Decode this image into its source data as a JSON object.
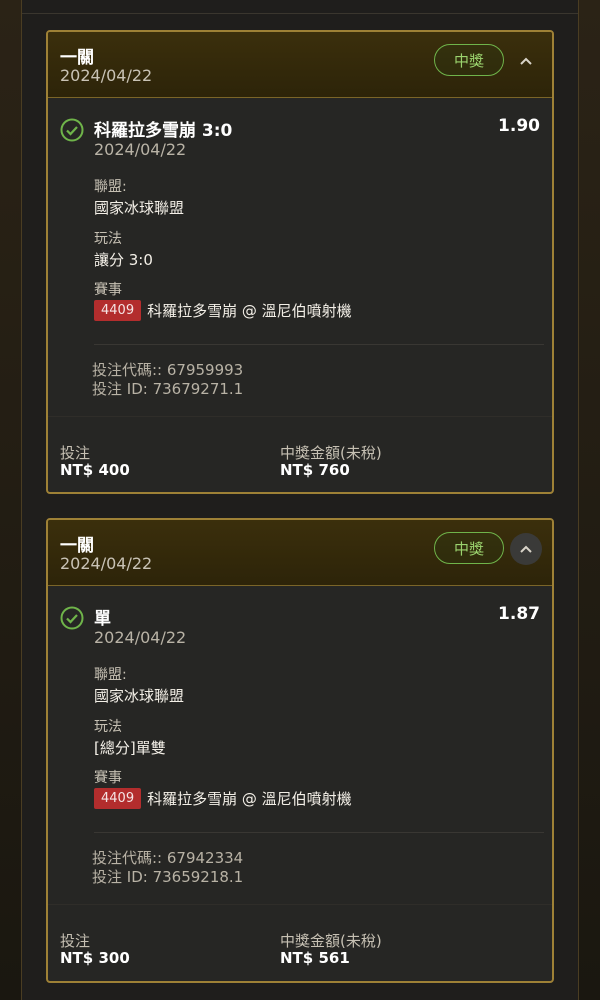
{
  "bets": [
    {
      "header": {
        "title": "一關",
        "date": "2024/04/22",
        "status": "中獎"
      },
      "selection": {
        "name": "科羅拉多雪崩 3:0",
        "odds": "1.90",
        "date": "2024/04/22",
        "league_label": "聯盟:",
        "league": "國家冰球聯盟",
        "market_label": "玩法",
        "market": "讓分 3:0",
        "event_label": "賽事",
        "event_id": "4409",
        "event": "科羅拉多雪崩 @ 溫尼伯噴射機"
      },
      "codes": {
        "bet_code": "投注代碼:: 67959993",
        "bet_id": "投注 ID: 73679271.1"
      },
      "summary": {
        "stake_label": "投注",
        "stake": "NT$ 400",
        "payout_label": "中獎金額(未稅)",
        "payout": "NT$ 760"
      }
    },
    {
      "header": {
        "title": "一關",
        "date": "2024/04/22",
        "status": "中獎"
      },
      "selection": {
        "name": "單",
        "odds": "1.87",
        "date": "2024/04/22",
        "league_label": "聯盟:",
        "league": "國家冰球聯盟",
        "market_label": "玩法",
        "market": "[總分]單雙",
        "event_label": "賽事",
        "event_id": "4409",
        "event": "科羅拉多雪崩 @ 溫尼伯噴射機"
      },
      "codes": {
        "bet_code": "投注代碼:: 67942334",
        "bet_id": "投注 ID: 73659218.1"
      },
      "summary": {
        "stake_label": "投注",
        "stake": "NT$ 300",
        "payout_label": "中獎金額(未稅)",
        "payout": "NT$ 561"
      }
    }
  ],
  "colors": {
    "accent_gold": "#9e8136",
    "win_green": "#6fb44a",
    "event_red": "#b32d2d"
  },
  "icons": {
    "status": "check-circle-icon",
    "toggle": "chevron-up-icon"
  }
}
